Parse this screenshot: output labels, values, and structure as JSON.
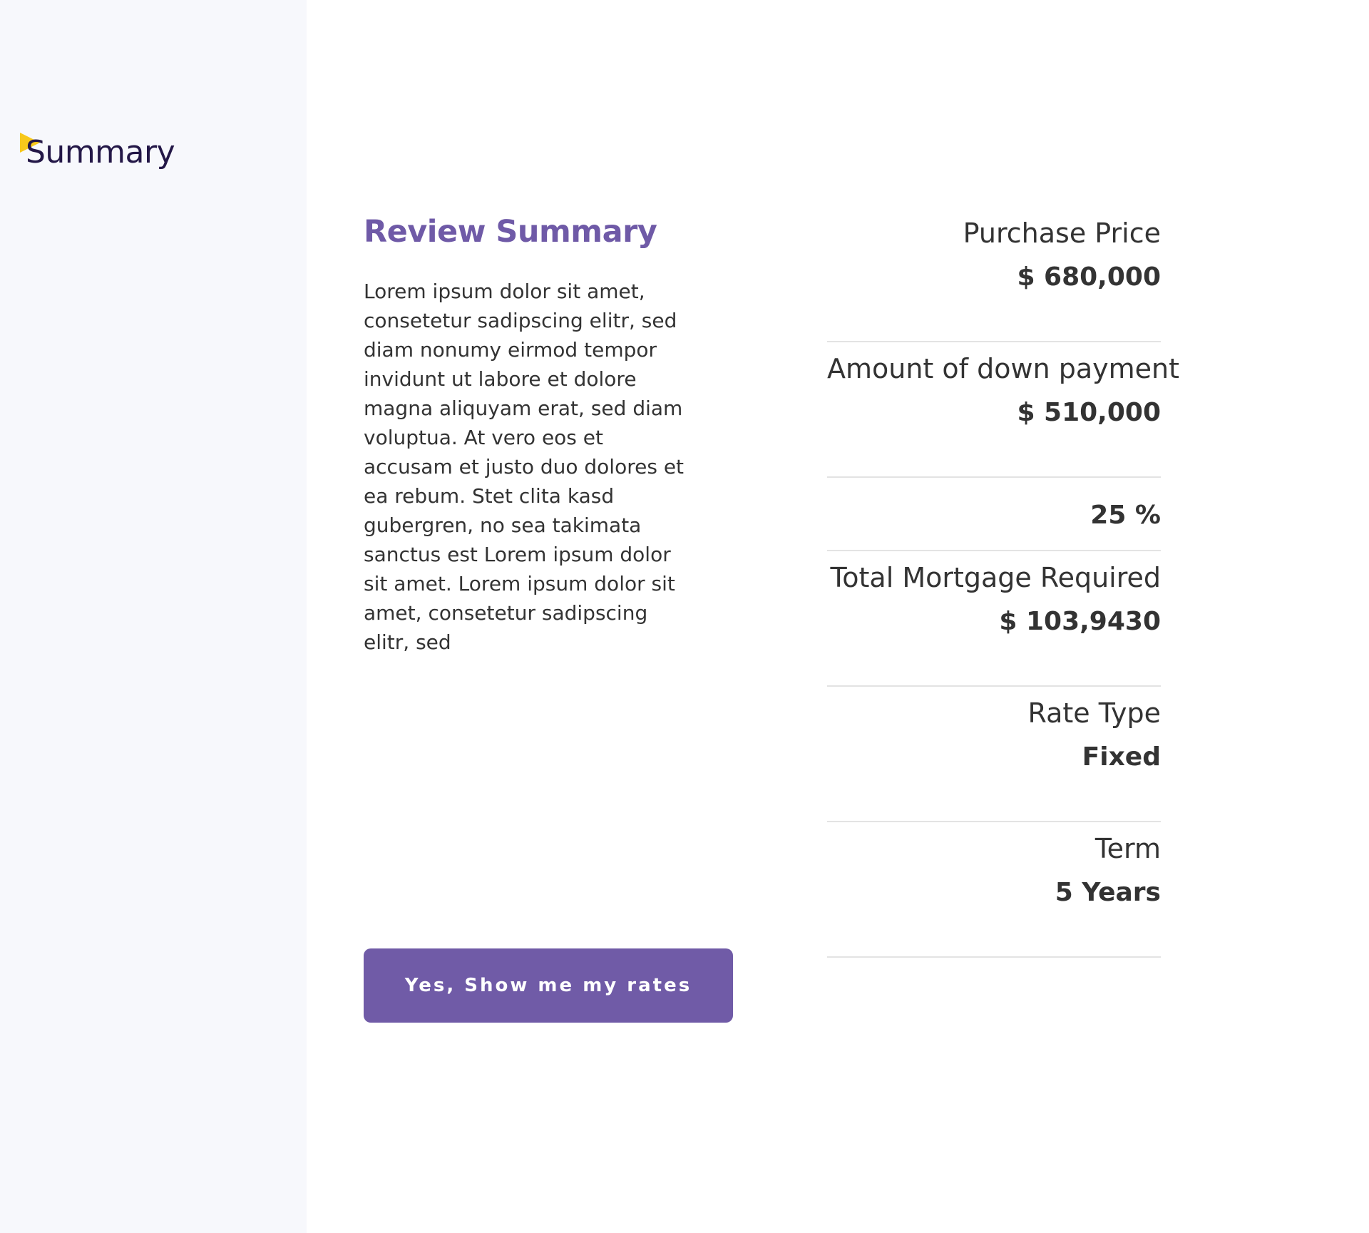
{
  "sidebar": {
    "brand_icon": "yellow-triangle-icon",
    "brand_label": "Summary",
    "accent_color": "#f7c81b"
  },
  "main": {
    "title": "Review Summary",
    "body": "Lorem ipsum dolor sit amet, consetetur sadipscing elitr, sed diam nonumy eirmod tempor invidunt ut labore et dolore magna aliquyam erat, sed diam voluptua. At vero eos et accusam et justo duo dolores et ea rebum. Stet clita kasd gubergren, no sea takimata sanctus est Lorem ipsum dolor sit amet. Lorem ipsum dolor sit amet, consetetur sadipscing elitr, sed",
    "cta_label": "Yes, Show me my rates",
    "title_color": "#6f5aa7",
    "button_color": "#705ba7"
  },
  "summary": {
    "purchase_price": {
      "label": "Purchase Price",
      "value": "$ 680,000"
    },
    "down_payment": {
      "label": "Amount of down payment",
      "value": "$ 510,000"
    },
    "down_payment_percent": {
      "value": "25 %"
    },
    "mortgage": {
      "label": "Total Mortgage Required",
      "value": "$ 103,9430"
    },
    "rate_type": {
      "label": "Rate Type",
      "value": "Fixed"
    },
    "term": {
      "label": "Term",
      "value": "5 Years"
    }
  }
}
